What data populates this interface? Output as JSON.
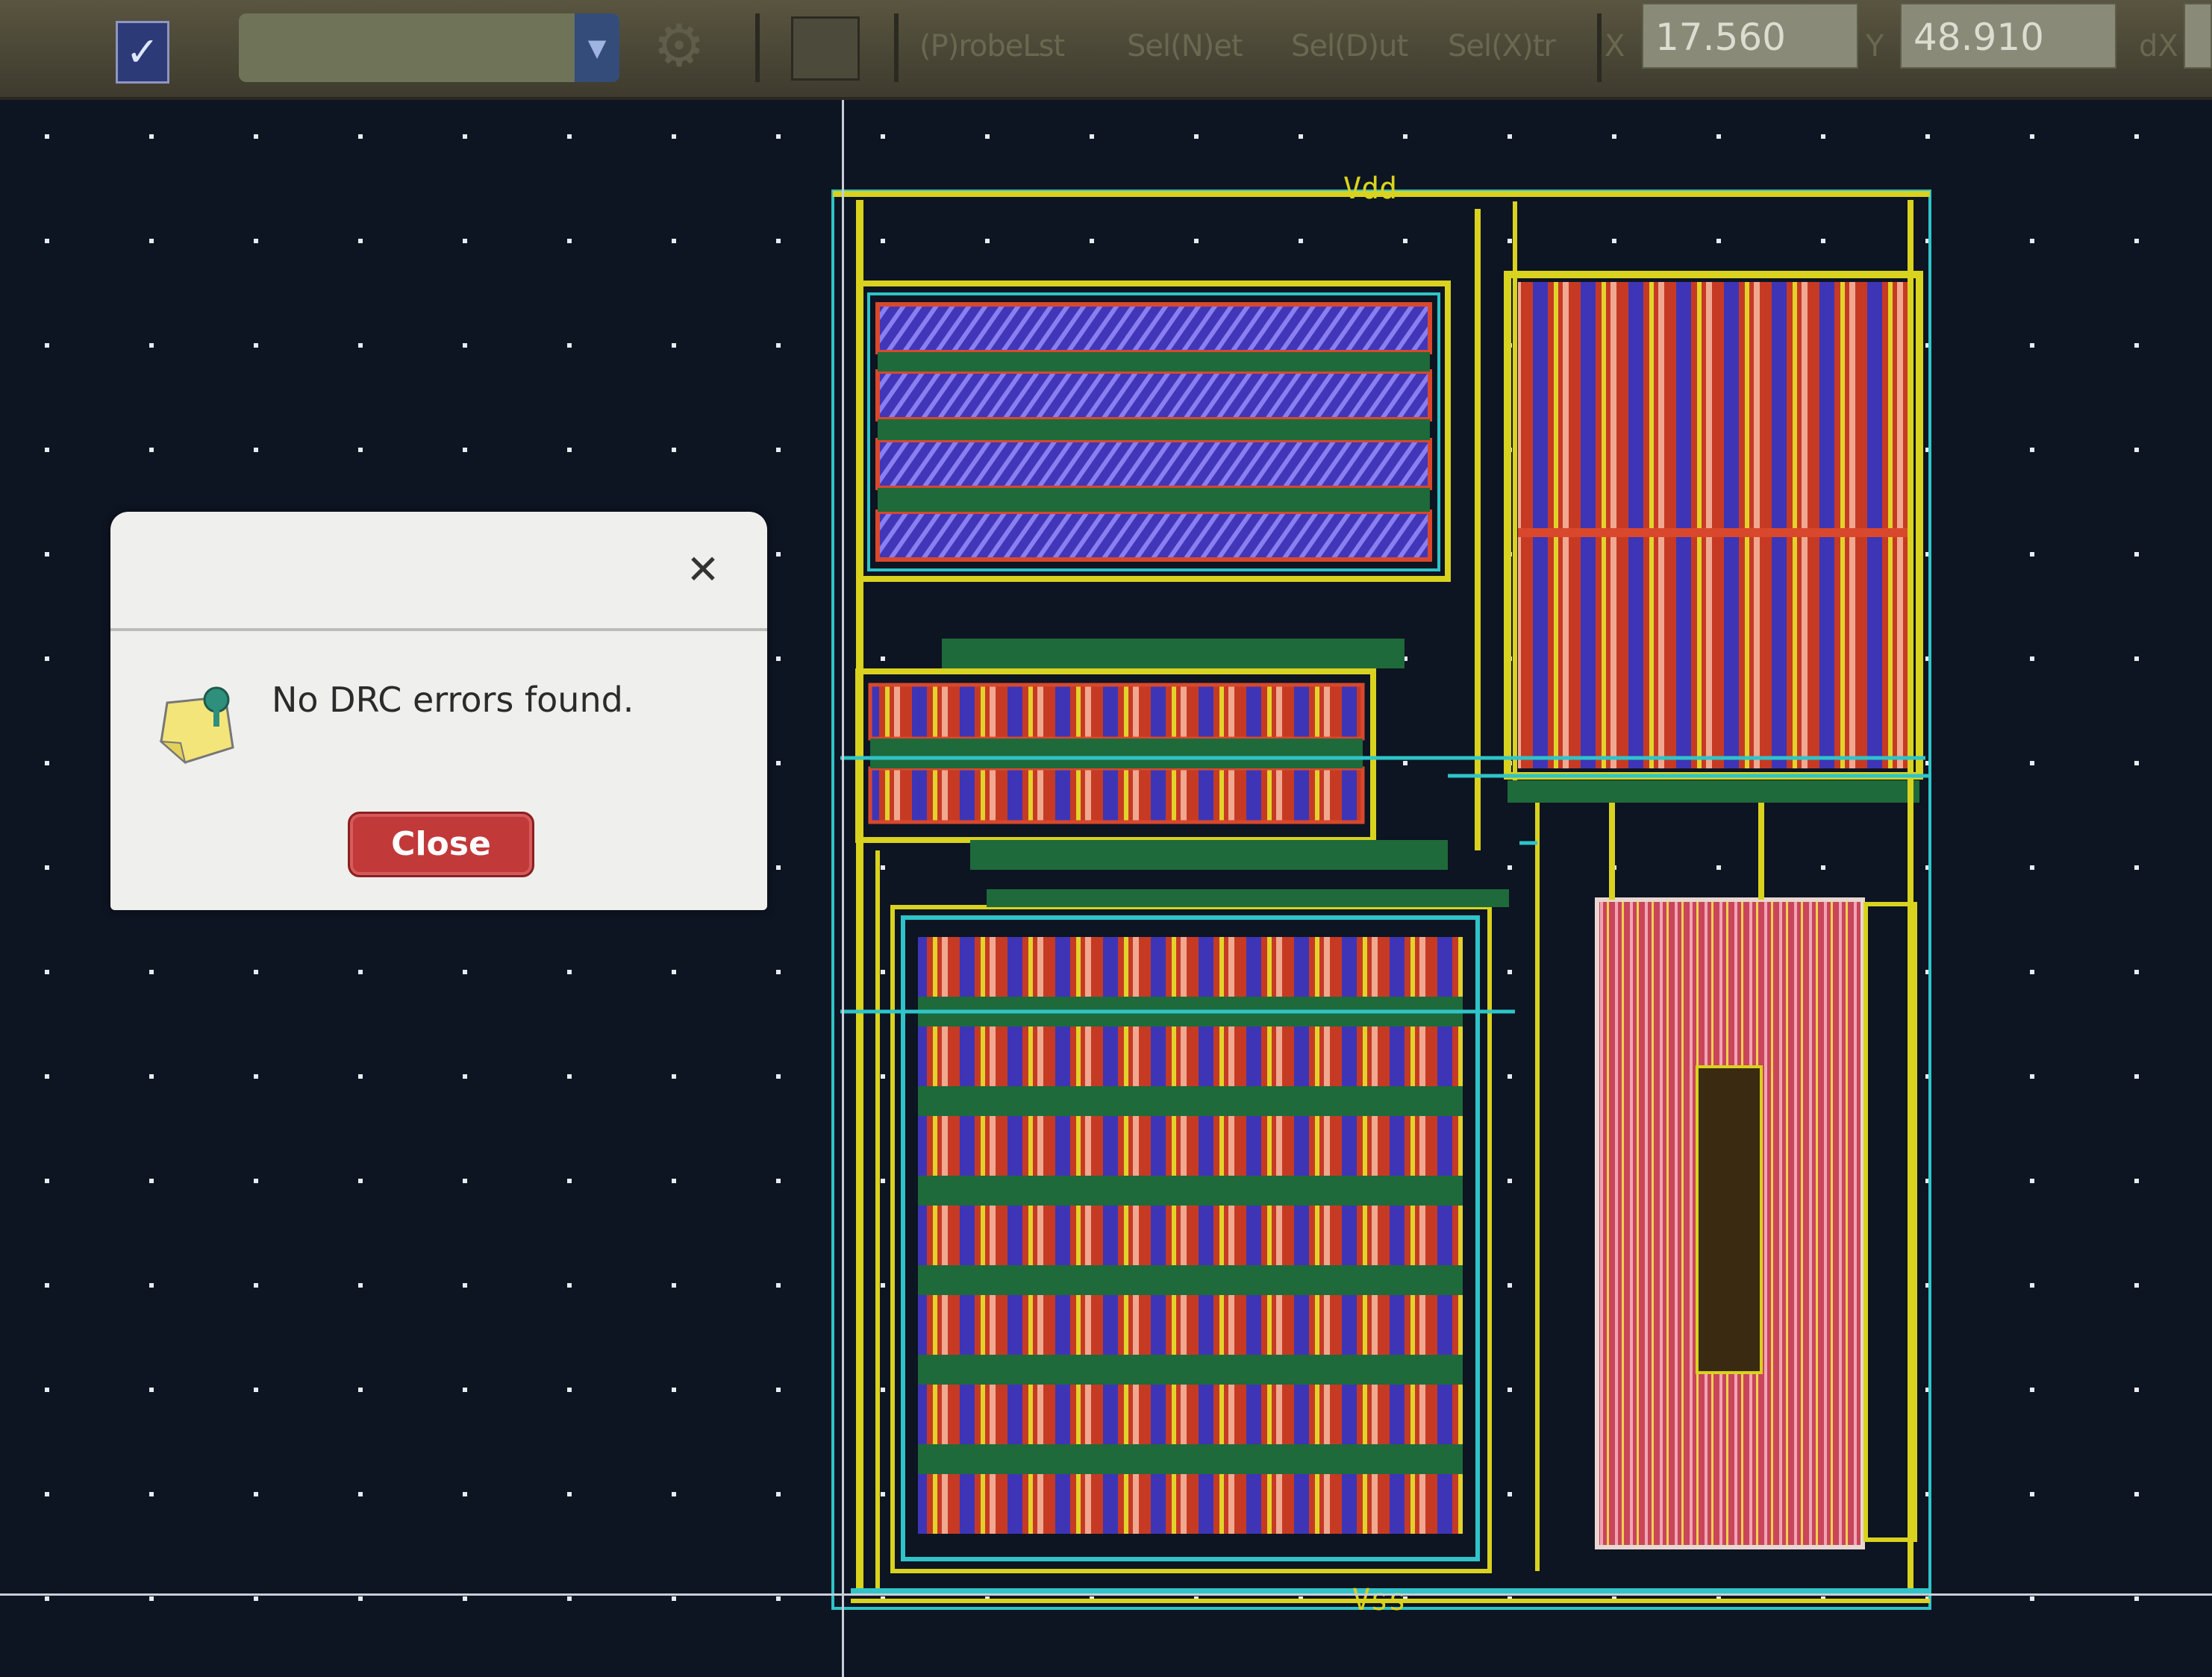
{
  "toolbar": {
    "check_glyph": "✓",
    "combo_value": "",
    "gear_icon": "gear-icon",
    "layers_icon": "layers-icon",
    "buttons": [
      "(P)robeLst",
      "Sel(N)et",
      "Sel(D)ut",
      "Sel(X)tr"
    ],
    "x_label": "X",
    "x_value": "17.560",
    "y_label": "Y",
    "y_value": "48.910",
    "dx_label": "dX"
  },
  "layout": {
    "top_label": "Vdd",
    "bottom_label": "Vss"
  },
  "dialog": {
    "close_glyph": "✕",
    "icon": "note-pin-icon",
    "message": "No DRC errors found.",
    "close_label": "Close"
  },
  "colors": {
    "background": "#0d1422",
    "grid_dot": "#e8ecf2",
    "metal_yellow": "#d9d21e",
    "cyan": "#2ec4c8",
    "poly_red": "#d9482c",
    "diff_blue": "#4b3fc9",
    "green": "#1e6a3a",
    "pink": "#e79fb4"
  }
}
